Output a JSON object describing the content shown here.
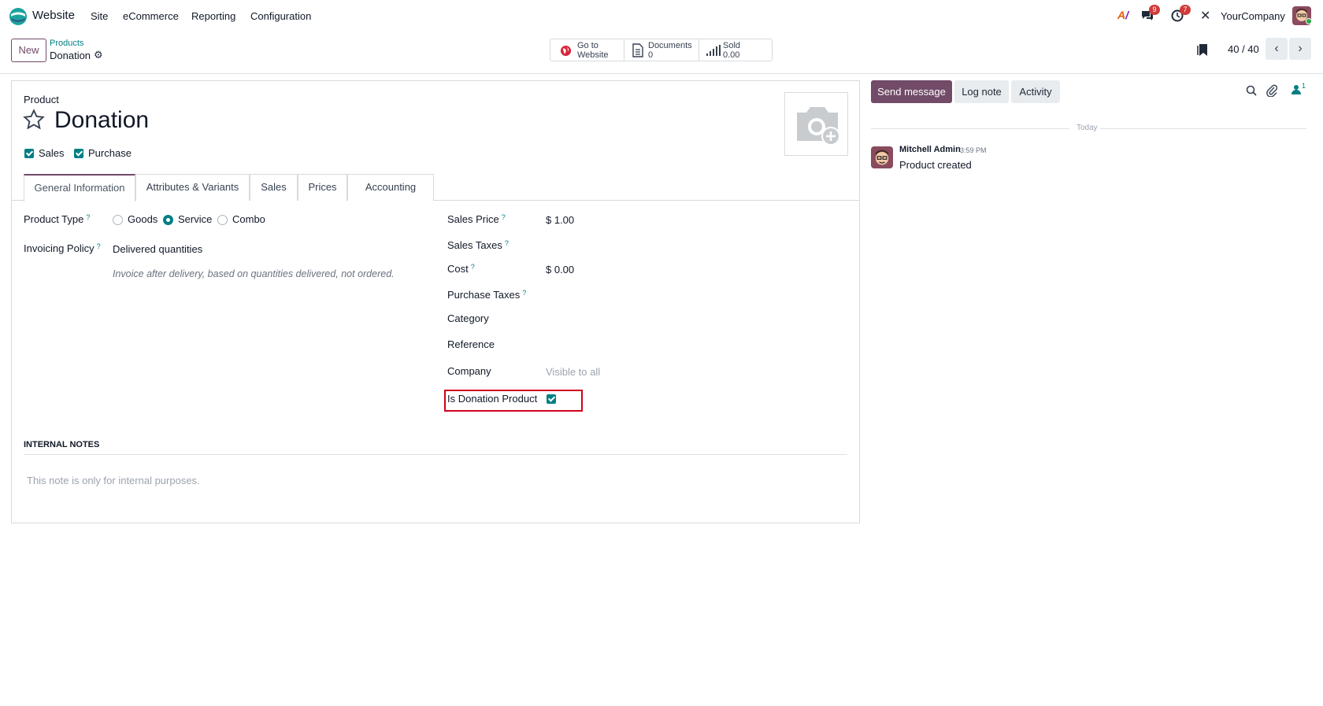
{
  "topnav": {
    "app_name": "Website",
    "menu": [
      "Site",
      "eCommerce",
      "Reporting",
      "Configuration"
    ],
    "messages_count": "9",
    "activities_count": "7",
    "company": "YourCompany"
  },
  "control_panel": {
    "new_label": "New",
    "breadcrumb_parent": "Products",
    "breadcrumb_current": "Donation",
    "smart_buttons": [
      {
        "line1": "Go to",
        "line2": "Website",
        "icon": "globe-icon"
      },
      {
        "line1": "Documents",
        "line2": "0",
        "icon": "document-icon"
      },
      {
        "line1": "Sold",
        "line2": "0.00",
        "icon": "bar-chart-icon"
      }
    ],
    "pager": "40 / 40"
  },
  "form": {
    "product_label": "Product",
    "product_name": "Donation",
    "sales_label": "Sales",
    "purchase_label": "Purchase",
    "tabs": [
      "General Information",
      "Attributes & Variants",
      "Sales",
      "Prices",
      "Accounting"
    ],
    "product_type_label": "Product Type",
    "product_type_options": [
      "Goods",
      "Service",
      "Combo"
    ],
    "product_type_selected": "Service",
    "invoicing_policy_label": "Invoicing Policy",
    "invoicing_policy_value": "Delivered quantities",
    "invoicing_policy_help": "Invoice after delivery, based on quantities delivered, not ordered.",
    "sales_price_label": "Sales Price",
    "sales_price_value": "$ 1.00",
    "sales_taxes_label": "Sales Taxes",
    "cost_label": "Cost",
    "cost_value": "$ 0.00",
    "purchase_taxes_label": "Purchase Taxes",
    "category_label": "Category",
    "reference_label": "Reference",
    "company_label": "Company",
    "company_placeholder": "Visible to all",
    "donation_label": "Is Donation Product",
    "internal_notes_title": "INTERNAL NOTES",
    "internal_notes_placeholder": "This note is only for internal purposes."
  },
  "chatter": {
    "send_message": "Send message",
    "log_note": "Log note",
    "activity": "Activity",
    "followers_count": "1",
    "date_separator": "Today",
    "author": "Mitchell Admin",
    "time": "3:59 PM",
    "message": "Product created"
  },
  "colors": {
    "primary": "#714B67",
    "teal": "#017e84",
    "highlight": "#d0021b"
  }
}
